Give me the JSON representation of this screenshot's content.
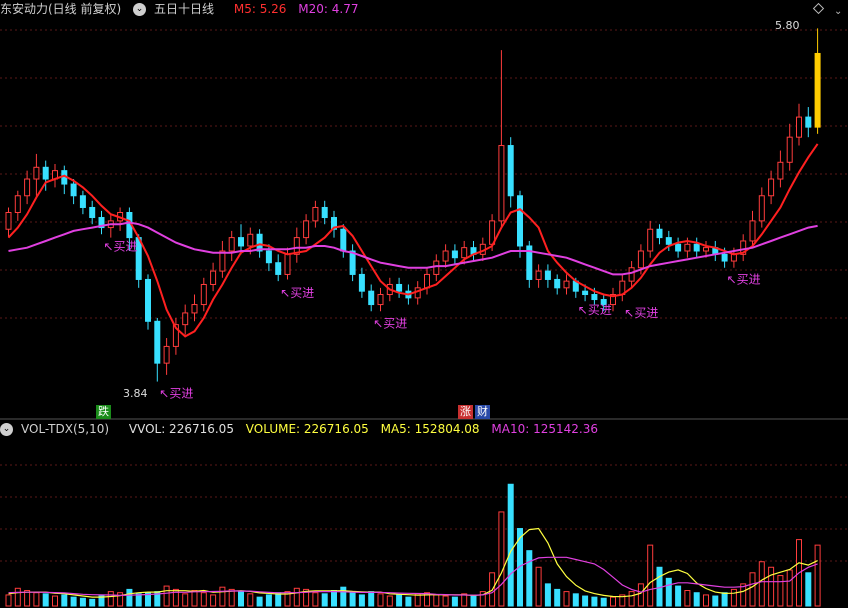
{
  "header": {
    "stock": "东安动力(日线 前复权)",
    "indicator": "五日十日线",
    "m5": "M5: 5.26",
    "m20": "M20: 4.77"
  },
  "vol_header": {
    "indicator": "VOL-TDX(5,10)",
    "vvol": "VVOL: 226716.05",
    "volume": "VOLUME: 226716.05",
    "ma5": "MA5: 152804.08",
    "ma10": "MA10: 125142.36"
  },
  "markers": {
    "fall": "跌",
    "rise": "涨",
    "finance": "财"
  },
  "colors": {
    "up": "#ff3d3d",
    "down": "#38e0ff",
    "ma5": "#ff2020",
    "ma20": "#e040e0",
    "highlight": "#ffcc00"
  },
  "chart_data": [
    {
      "type": "candlestick",
      "high_label": "5.80",
      "low_label": "3.84",
      "signal_label": "买进",
      "ylim": [
        3.7,
        6.0
      ],
      "candles": [
        [
          4.75,
          4.85,
          4.7,
          4.88
        ],
        [
          4.85,
          4.95,
          4.8,
          4.98
        ],
        [
          4.95,
          5.05,
          4.9,
          5.1
        ],
        [
          5.05,
          5.12,
          4.95,
          5.2
        ],
        [
          5.12,
          5.05,
          4.98,
          5.16
        ],
        [
          5.05,
          5.1,
          5.0,
          5.14
        ],
        [
          5.1,
          5.02,
          4.96,
          5.13
        ],
        [
          5.02,
          4.95,
          4.9,
          5.05
        ],
        [
          4.95,
          4.88,
          4.84,
          4.98
        ],
        [
          4.88,
          4.82,
          4.78,
          4.92
        ],
        [
          4.82,
          4.76,
          4.72,
          4.86
        ],
        [
          4.76,
          4.8,
          4.7,
          4.84
        ],
        [
          4.8,
          4.85,
          4.74,
          4.88
        ],
        [
          4.85,
          4.7,
          4.62,
          4.88
        ],
        [
          4.7,
          4.45,
          4.4,
          4.72
        ],
        [
          4.45,
          4.2,
          4.15,
          4.48
        ],
        [
          4.2,
          3.95,
          3.84,
          4.22
        ],
        [
          3.95,
          4.05,
          3.88,
          4.1
        ],
        [
          4.05,
          4.18,
          4.0,
          4.22
        ],
        [
          4.18,
          4.25,
          4.12,
          4.3
        ],
        [
          4.25,
          4.3,
          4.2,
          4.36
        ],
        [
          4.3,
          4.42,
          4.26,
          4.46
        ],
        [
          4.42,
          4.5,
          4.38,
          4.55
        ],
        [
          4.5,
          4.62,
          4.46,
          4.68
        ],
        [
          4.62,
          4.7,
          4.56,
          4.74
        ],
        [
          4.7,
          4.65,
          4.6,
          4.78
        ],
        [
          4.65,
          4.72,
          4.6,
          4.76
        ],
        [
          4.72,
          4.62,
          4.58,
          4.75
        ],
        [
          4.62,
          4.55,
          4.5,
          4.66
        ],
        [
          4.55,
          4.48,
          4.44,
          4.6
        ],
        [
          4.48,
          4.6,
          4.45,
          4.64
        ],
        [
          4.6,
          4.7,
          4.55,
          4.76
        ],
        [
          4.7,
          4.8,
          4.66,
          4.84
        ],
        [
          4.8,
          4.88,
          4.76,
          4.92
        ],
        [
          4.88,
          4.82,
          4.78,
          4.92
        ],
        [
          4.82,
          4.75,
          4.7,
          4.86
        ],
        [
          4.75,
          4.62,
          4.58,
          4.78
        ],
        [
          4.62,
          4.48,
          4.44,
          4.66
        ],
        [
          4.48,
          4.38,
          4.34,
          4.52
        ],
        [
          4.38,
          4.3,
          4.26,
          4.42
        ],
        [
          4.3,
          4.36,
          4.26,
          4.4
        ],
        [
          4.36,
          4.42,
          4.32,
          4.46
        ],
        [
          4.42,
          4.38,
          4.34,
          4.46
        ],
        [
          4.38,
          4.34,
          4.3,
          4.42
        ],
        [
          4.34,
          4.4,
          4.3,
          4.44
        ],
        [
          4.4,
          4.48,
          4.36,
          4.52
        ],
        [
          4.48,
          4.56,
          4.44,
          4.6
        ],
        [
          4.56,
          4.62,
          4.52,
          4.66
        ],
        [
          4.62,
          4.58,
          4.54,
          4.66
        ],
        [
          4.58,
          4.64,
          4.54,
          4.68
        ],
        [
          4.64,
          4.6,
          4.56,
          4.68
        ],
        [
          4.6,
          4.66,
          4.56,
          4.7
        ],
        [
          4.66,
          4.8,
          4.62,
          4.84
        ],
        [
          4.8,
          5.25,
          4.76,
          5.82
        ],
        [
          5.25,
          4.95,
          4.88,
          5.3
        ],
        [
          4.95,
          4.65,
          4.58,
          4.98
        ],
        [
          4.65,
          4.45,
          4.4,
          4.68
        ],
        [
          4.45,
          4.5,
          4.4,
          4.54
        ],
        [
          4.5,
          4.45,
          4.4,
          4.54
        ],
        [
          4.45,
          4.4,
          4.36,
          4.48
        ],
        [
          4.4,
          4.44,
          4.36,
          4.48
        ],
        [
          4.44,
          4.38,
          4.34,
          4.46
        ],
        [
          4.38,
          4.36,
          4.32,
          4.42
        ],
        [
          4.36,
          4.33,
          4.3,
          4.4
        ],
        [
          4.33,
          4.3,
          4.26,
          4.36
        ],
        [
          4.3,
          4.36,
          4.26,
          4.4
        ],
        [
          4.36,
          4.44,
          4.32,
          4.48
        ],
        [
          4.44,
          4.52,
          4.4,
          4.56
        ],
        [
          4.52,
          4.62,
          4.48,
          4.66
        ],
        [
          4.62,
          4.75,
          4.58,
          4.8
        ],
        [
          4.75,
          4.7,
          4.66,
          4.78
        ],
        [
          4.7,
          4.66,
          4.62,
          4.74
        ],
        [
          4.66,
          4.62,
          4.58,
          4.7
        ],
        [
          4.62,
          4.66,
          4.58,
          4.7
        ],
        [
          4.66,
          4.62,
          4.58,
          4.7
        ],
        [
          4.62,
          4.64,
          4.58,
          4.68
        ],
        [
          4.64,
          4.6,
          4.56,
          4.68
        ],
        [
          4.6,
          4.56,
          4.52,
          4.64
        ],
        [
          4.56,
          4.6,
          4.52,
          4.64
        ],
        [
          4.6,
          4.68,
          4.56,
          4.72
        ],
        [
          4.68,
          4.8,
          4.64,
          4.86
        ],
        [
          4.8,
          4.95,
          4.76,
          5.0
        ],
        [
          4.95,
          5.05,
          4.9,
          5.1
        ],
        [
          5.05,
          5.15,
          5.0,
          5.22
        ],
        [
          5.15,
          5.3,
          5.1,
          5.38
        ],
        [
          5.3,
          5.42,
          5.25,
          5.5
        ],
        [
          5.42,
          5.36,
          5.3,
          5.48
        ],
        [
          5.36,
          5.8,
          5.32,
          5.95
        ]
      ],
      "ma5": [
        4.7,
        4.76,
        4.84,
        4.94,
        5.03,
        5.05,
        5.07,
        5.04,
        5.0,
        4.95,
        4.89,
        4.84,
        4.82,
        4.8,
        4.7,
        4.59,
        4.44,
        4.27,
        4.16,
        4.11,
        4.14,
        4.22,
        4.33,
        4.42,
        4.52,
        4.61,
        4.64,
        4.66,
        4.65,
        4.62,
        4.6,
        4.61,
        4.62,
        4.66,
        4.7,
        4.76,
        4.77,
        4.71,
        4.62,
        4.53,
        4.44,
        4.39,
        4.37,
        4.36,
        4.38,
        4.4,
        4.42,
        4.47,
        4.52,
        4.57,
        4.6,
        4.62,
        4.65,
        4.76,
        4.85,
        4.87,
        4.82,
        4.76,
        4.62,
        4.55,
        4.49,
        4.44,
        4.41,
        4.38,
        4.36,
        4.35,
        4.36,
        4.4,
        4.46,
        4.54,
        4.61,
        4.65,
        4.67,
        4.68,
        4.67,
        4.65,
        4.64,
        4.62,
        4.6,
        4.61,
        4.65,
        4.72,
        4.8,
        4.88,
        4.99,
        5.09,
        5.18,
        5.26
      ],
      "ma20": [
        4.62,
        4.63,
        4.64,
        4.66,
        4.68,
        4.7,
        4.72,
        4.74,
        4.75,
        4.76,
        4.77,
        4.78,
        4.78,
        4.79,
        4.78,
        4.76,
        4.73,
        4.7,
        4.67,
        4.65,
        4.63,
        4.62,
        4.61,
        4.61,
        4.61,
        4.62,
        4.62,
        4.63,
        4.63,
        4.63,
        4.63,
        4.64,
        4.64,
        4.65,
        4.65,
        4.64,
        4.62,
        4.61,
        4.59,
        4.57,
        4.55,
        4.54,
        4.53,
        4.52,
        4.52,
        4.52,
        4.53,
        4.53,
        4.54,
        4.55,
        4.56,
        4.57,
        4.58,
        4.6,
        4.62,
        4.62,
        4.62,
        4.61,
        4.6,
        4.59,
        4.58,
        4.56,
        4.54,
        4.52,
        4.5,
        4.48,
        4.48,
        4.49,
        4.51,
        4.53,
        4.54,
        4.55,
        4.56,
        4.57,
        4.58,
        4.59,
        4.6,
        4.61,
        4.62,
        4.63,
        4.64,
        4.66,
        4.68,
        4.7,
        4.72,
        4.74,
        4.76,
        4.77
      ],
      "signals": [
        10,
        16,
        29,
        39,
        61,
        66,
        77
      ]
    },
    {
      "type": "bar",
      "ylim": [
        0,
        300000
      ],
      "volume": [
        20000,
        32000,
        28000,
        24000,
        22000,
        18000,
        20000,
        16000,
        14000,
        12000,
        18000,
        26000,
        24000,
        30000,
        22000,
        24000,
        26000,
        36000,
        30000,
        22000,
        28000,
        24000,
        20000,
        34000,
        30000,
        26000,
        22000,
        16000,
        20000,
        24000,
        26000,
        32000,
        30000,
        24000,
        22000,
        28000,
        34000,
        24000,
        20000,
        26000,
        22000,
        18000,
        20000,
        16000,
        22000,
        24000,
        20000,
        18000,
        16000,
        22000,
        18000,
        26000,
        60000,
        170000,
        220000,
        140000,
        100000,
        70000,
        40000,
        30000,
        26000,
        22000,
        18000,
        16000,
        14000,
        16000,
        20000,
        26000,
        40000,
        110000,
        70000,
        50000,
        36000,
        28000,
        24000,
        20000,
        18000,
        24000,
        30000,
        40000,
        60000,
        80000,
        70000,
        55000,
        65000,
        120000,
        60000,
        110000
      ],
      "ma5": [
        22000,
        24000,
        25000,
        25200,
        25200,
        23000,
        22400,
        20000,
        18000,
        16000,
        16000,
        17200,
        18800,
        22000,
        24000,
        25200,
        25200,
        27600,
        27600,
        27600,
        26400,
        28000,
        24800,
        25600,
        26800,
        27600,
        26400,
        23600,
        22800,
        21600,
        21600,
        23600,
        26400,
        27200,
        27200,
        27200,
        27600,
        26400,
        25600,
        25200,
        25200,
        22000,
        21200,
        20400,
        19600,
        20000,
        20400,
        20000,
        20000,
        20000,
        19200,
        20200,
        28400,
        59600,
        98800,
        123200,
        138000,
        140000,
        114000,
        76000,
        53200,
        37600,
        27200,
        22400,
        19200,
        17200,
        16800,
        18400,
        23200,
        42400,
        53200,
        61200,
        65200,
        58800,
        41600,
        31600,
        25200,
        22800,
        23200,
        26400,
        34800,
        46800,
        56000,
        61000,
        66000,
        78000,
        74000,
        82000
      ],
      "ma10": [
        24000,
        24500,
        25000,
        25000,
        24800,
        24200,
        23600,
        22400,
        21200,
        20400,
        20000,
        19800,
        19200,
        19600,
        20000,
        20800,
        21600,
        23200,
        25000,
        24800,
        25600,
        25800,
        26200,
        26600,
        27200,
        27000,
        27000,
        25600,
        24600,
        23800,
        24000,
        24000,
        24800,
        25800,
        26000,
        26000,
        25600,
        25000,
        24600,
        24600,
        24600,
        24000,
        23400,
        23000,
        22600,
        22400,
        21200,
        20600,
        19800,
        19800,
        19600,
        20000,
        24000,
        39000,
        58000,
        72000,
        80000,
        87000,
        88000,
        88000,
        88000,
        84000,
        80000,
        76000,
        66000,
        52000,
        38000,
        30000,
        25000,
        30000,
        33000,
        38000,
        42000,
        42000,
        40000,
        38000,
        36000,
        34000,
        34000,
        35000,
        40000,
        44000,
        44000,
        44000,
        45000,
        60000,
        70000,
        76000
      ]
    }
  ]
}
